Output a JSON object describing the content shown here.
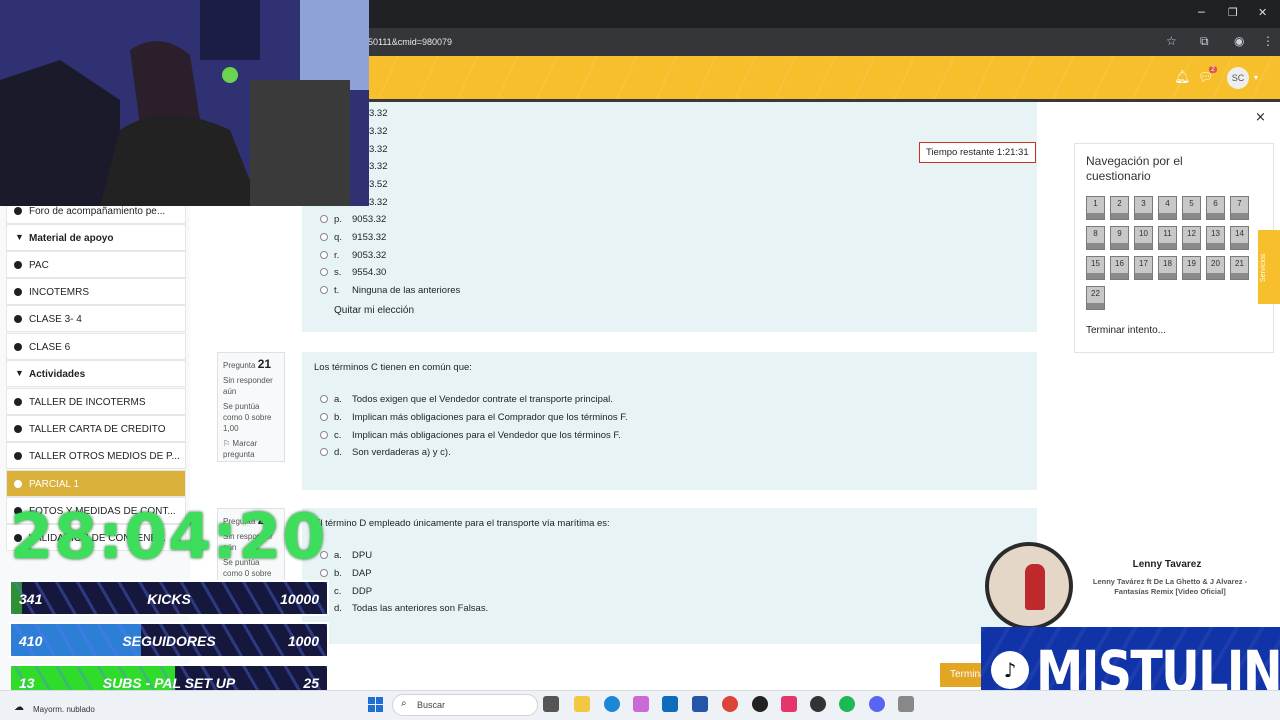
{
  "browser": {
    "url": "50111&cmid=980079",
    "minimize": "─",
    "restore": "❐",
    "close": "✕"
  },
  "header": {
    "notification_count": "2",
    "user_initials": "SC"
  },
  "drawer": {
    "items": [
      {
        "type": "item",
        "label": "Foro de acompañamiento pe..."
      },
      {
        "type": "section",
        "label": "Material de apoyo"
      },
      {
        "type": "item",
        "label": "PAC"
      },
      {
        "type": "item",
        "label": "INCOTEMRS"
      },
      {
        "type": "item",
        "label": "CLASE 3- 4"
      },
      {
        "type": "item",
        "label": "CLASE 6"
      },
      {
        "type": "section",
        "label": "Actividades"
      },
      {
        "type": "item",
        "label": "TALLER DE INCOTERMS"
      },
      {
        "type": "item",
        "label": "TALLER CARTA DE CREDITO"
      },
      {
        "type": "item",
        "label": "TALLER OTROS MEDIOS DE P..."
      },
      {
        "type": "item",
        "label": "PARCIAL 1",
        "active": true
      },
      {
        "type": "item",
        "label": "FOTOS Y MEDIDAS DE CONT..."
      },
      {
        "type": "item",
        "label": "VALIDACIÓN DE CONTENE..."
      }
    ]
  },
  "timer": {
    "label": "Tiempo restante 1:21:31"
  },
  "question20": {
    "partial_options": [
      "3.32",
      "3.32",
      "3.32",
      "3.32",
      "3.52",
      "3.32"
    ],
    "options": [
      {
        "letter": "p.",
        "text": "9053.32"
      },
      {
        "letter": "q.",
        "text": "9153.32"
      },
      {
        "letter": "r.",
        "text": "9053.32"
      },
      {
        "letter": "s.",
        "text": "9554.30"
      },
      {
        "letter": "t.",
        "text": "Ninguna de las anteriores"
      }
    ],
    "clear_choice": "Quitar mi elección"
  },
  "question21": {
    "label": "Pregunta",
    "number": "21",
    "status": "Sin responder aún",
    "score": "Se puntúa como 0 sobre 1,00",
    "flag": "Marcar pregunta",
    "text": "Los términos C tienen en común que:",
    "options": [
      {
        "letter": "a.",
        "text": "Todos exigen que el Vendedor contrate el transporte principal."
      },
      {
        "letter": "b.",
        "text": "Implican más obligaciones para el Comprador que los términos F."
      },
      {
        "letter": "c.",
        "text": "Implican más obligaciones para el Vendedor que los términos F."
      },
      {
        "letter": "d.",
        "text": "Son verdaderas a) y c)."
      }
    ]
  },
  "question22": {
    "label": "Pregunta",
    "number": "22",
    "status": "Sin responder aún",
    "score": "Se puntúa como 0 sobre 1,00",
    "text": "El término D empleado únicamente para el transporte vía marítima es:",
    "options": [
      {
        "letter": "a.",
        "text": "DPU"
      },
      {
        "letter": "b.",
        "text": "DAP"
      },
      {
        "letter": "c.",
        "text": "DDP"
      },
      {
        "letter": "d.",
        "text": "Todas las anteriores son Falsas."
      }
    ]
  },
  "quiz_nav": {
    "title": "Navegación por el cuestionario",
    "buttons": [
      "1",
      "2",
      "3",
      "4",
      "5",
      "6",
      "7",
      "8",
      "9",
      "10",
      "11",
      "12",
      "13",
      "14",
      "15",
      "16",
      "17",
      "18",
      "19",
      "20",
      "21",
      "22"
    ],
    "finish_link": "Terminar intento...",
    "close": "×",
    "side_tab": "Servicios"
  },
  "finish_button": "Terminar",
  "overlay": {
    "clock": "28:04:20",
    "stats": [
      {
        "current": "341",
        "name": "KICKS",
        "goal": "10000",
        "progress": 0.034,
        "color": "#2f8f34"
      },
      {
        "current": "410",
        "name": "SEGUIDORES",
        "goal": "1000",
        "progress": 0.41,
        "color": "#2d7fd6"
      },
      {
        "current": "13",
        "name": "SUBS - PAL SET UP",
        "goal": "25",
        "progress": 0.52,
        "color": "#2fdc2a"
      }
    ],
    "now_playing": {
      "artist": "Lenny Tavarez",
      "title": "Lenny Tavárez ft De La Ghetto & J Alvarez - Fantasías Remix [Video Oficial]"
    },
    "brand": "MISTULINO"
  },
  "taskbar": {
    "weather": "Mayorm. nublado",
    "search_placeholder": "Buscar"
  }
}
